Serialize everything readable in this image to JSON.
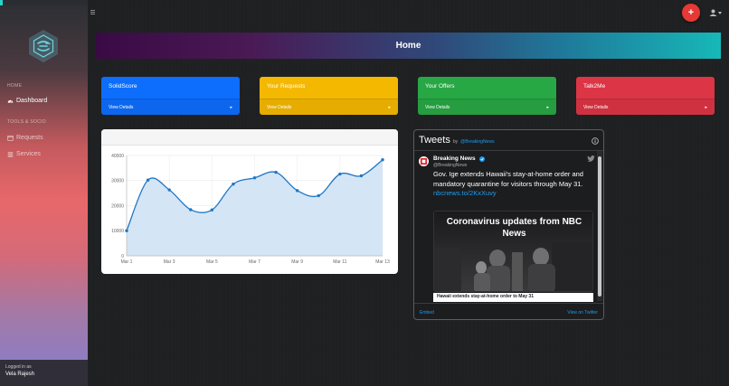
{
  "sidebar": {
    "section_home": "HOME",
    "section_requests": "TOOLS & SOCIO",
    "items": [
      {
        "label": "Dashboard",
        "icon": "dashboard-icon",
        "active": true
      },
      {
        "label": "Requests",
        "icon": "calendar-icon",
        "active": false
      },
      {
        "label": "Services",
        "icon": "list-icon",
        "active": false
      }
    ],
    "logged_label": "Logged in as",
    "logged_name": "Vela Rajesh"
  },
  "topbar": {
    "fab_label": "+",
    "menu_icon": "hamburger-icon",
    "user_icon": "user-icon"
  },
  "header": {
    "title": "Home"
  },
  "cards": [
    {
      "title": "SolidScore",
      "link": "View Details",
      "color": "#0d6efd"
    },
    {
      "title": "Your Requests",
      "link": "View Details",
      "color": "#f5b800"
    },
    {
      "title": "Your Offers",
      "link": "View Details",
      "color": "#28a745"
    },
    {
      "title": "Talk2Me",
      "link": "View Details",
      "color": "#dc3545"
    }
  ],
  "chart_data": {
    "type": "area",
    "x": [
      "Mar 1",
      "Mar 2",
      "Mar 3",
      "Mar 4",
      "Mar 5",
      "Mar 6",
      "Mar 7",
      "Mar 8",
      "Mar 9",
      "Mar 10",
      "Mar 11",
      "Mar 12",
      "Mar 13"
    ],
    "x_tick_labels": [
      "Mar 1",
      "Mar 3",
      "Mar 5",
      "Mar 7",
      "Mar 9",
      "Mar 11",
      "Mar 13"
    ],
    "values": [
      10000,
      30200,
      26300,
      18400,
      18300,
      28600,
      31100,
      33300,
      26000,
      24000,
      32600,
      31900,
      38300
    ],
    "ylim": [
      0,
      40000
    ],
    "y_ticks": [
      "0",
      "10000",
      "20000",
      "30000",
      "40000"
    ],
    "grid": true,
    "line_color": "#1f77c4",
    "fill_color": "#cfe2f5"
  },
  "tweets": {
    "title": "Tweets",
    "by": "by",
    "handle": "@BreakingNews",
    "author_name": "Breaking News",
    "author_handle": "@BreakingNews",
    "text": "Gov. Ige extends Hawaii's stay-at-home order and mandatory quarantine for visitors through May 31.",
    "link": "nbcnews.to/2KxXuvy",
    "media_title": "Coronavirus updates from NBC News",
    "media_caption": "Hawaii extends stay-at-home order to May 31",
    "embed": "Embed",
    "view": "View on Twitter"
  }
}
